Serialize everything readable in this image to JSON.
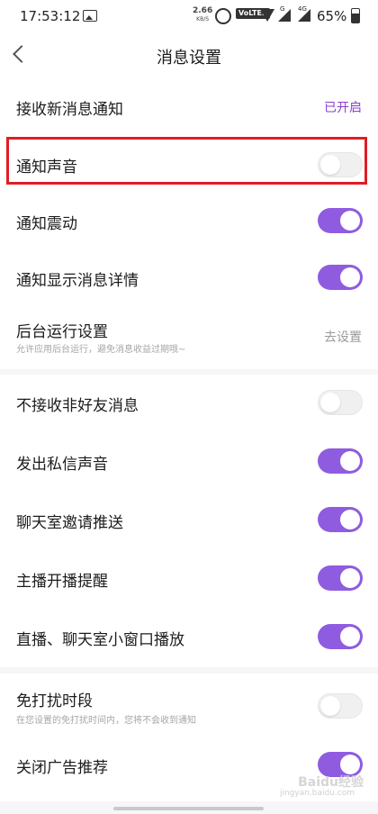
{
  "status_bar": {
    "time": "17:53:12",
    "net_speed": "2.66",
    "net_unit": "KB/S",
    "volte": "VoLTE2",
    "signal1_label": "G",
    "signal2_label": "4G",
    "battery": "65%"
  },
  "nav": {
    "title": "消息设置"
  },
  "rows": [
    {
      "label": "接收新消息通知",
      "value": "已开启"
    },
    {
      "label": "通知声音",
      "toggle": "off"
    },
    {
      "label": "通知震动",
      "toggle": "on"
    },
    {
      "label": "通知显示消息详情",
      "toggle": "on"
    },
    {
      "label": "后台运行设置",
      "sub": "允许应用后台运行，避免消息收益过期哦~",
      "value": "去设置"
    },
    {
      "label": "不接收非好友消息",
      "toggle": "off"
    },
    {
      "label": "发出私信声音",
      "toggle": "on"
    },
    {
      "label": "聊天室邀请推送",
      "toggle": "on"
    },
    {
      "label": "主播开播提醒",
      "toggle": "on"
    },
    {
      "label": "直播、聊天室小窗口播放",
      "toggle": "on"
    },
    {
      "label": "免打扰时段",
      "sub": "在您设置的免打扰时间内，您将不会收到通知",
      "toggle": "off"
    },
    {
      "label": "关闭广告推荐",
      "toggle": "on"
    }
  ],
  "watermark": {
    "text": "Baidu经验",
    "sub": "jingyan.baidu.com"
  },
  "colors": {
    "accent": "#8f5ce0",
    "value_purple": "#8a3fd1",
    "highlight": "#e01d25"
  }
}
